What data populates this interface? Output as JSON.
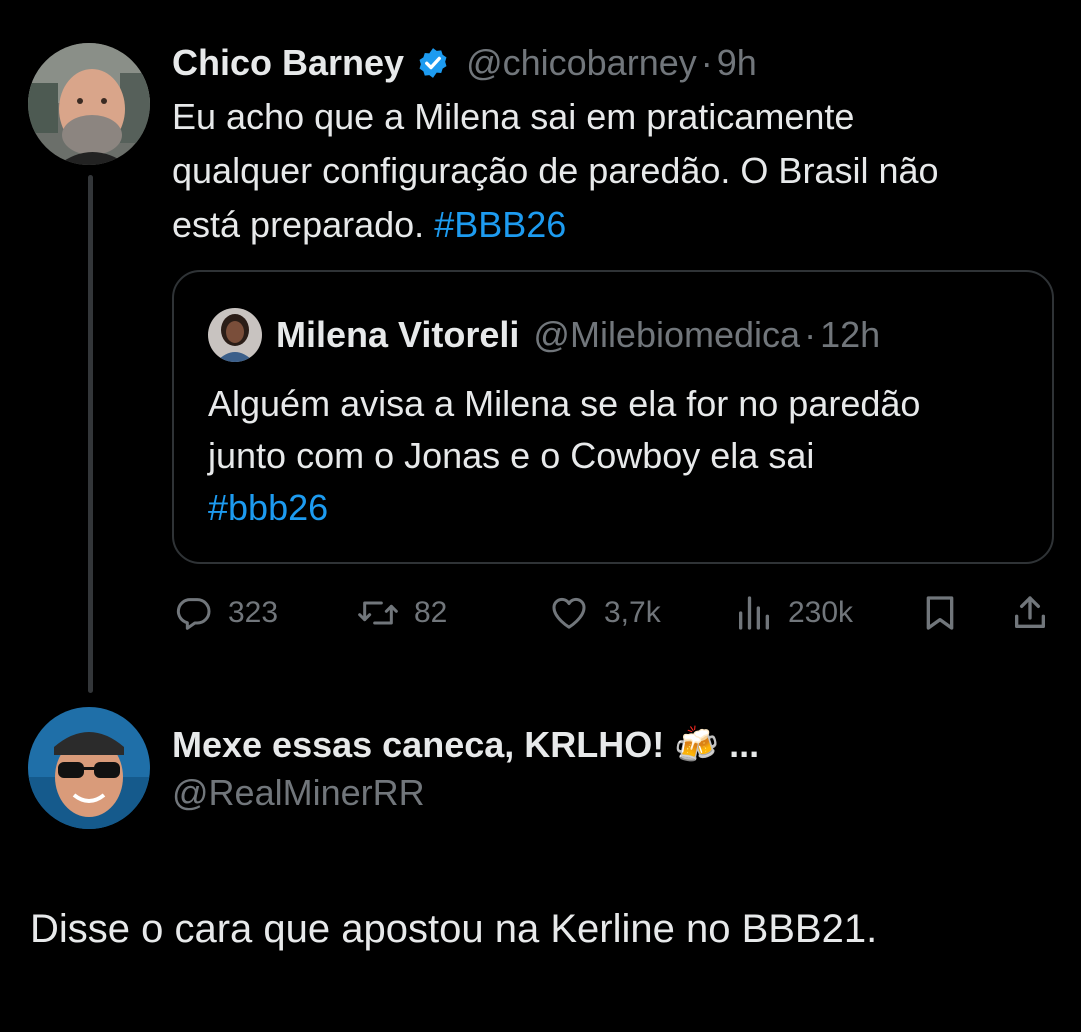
{
  "main_tweet": {
    "display_name": "Chico Barney",
    "handle": "@chicobarney",
    "time": "9h",
    "text_line1": "Eu acho que a Milena sai em praticamente",
    "text_line2": "qualquer configuração de paredão. O Brasil não",
    "text_line3": "está preparado.",
    "hashtag": "#BBB26",
    "quoted": {
      "display_name": "Milena Vitoreli",
      "handle": "@Milebiomedica",
      "time": "12h",
      "text_line1": "Alguém avisa a Milena se ela for no paredão",
      "text_line2": "junto com o Jonas e o Cowboy ela sai",
      "hashtag": "#bbb26"
    },
    "actions": {
      "replies": "323",
      "retweets": "82",
      "likes": "3,7k",
      "views": "230k"
    }
  },
  "reply": {
    "display_name": "Mexe essas caneca, KRLHO! 🍻 ...",
    "handle": "@RealMinerRR",
    "text": "Disse o cara que apostou na Kerline no BBB21."
  },
  "colors": {
    "background": "#000000",
    "text": "#e7e9ea",
    "muted": "#71767b",
    "link": "#1d9bf0",
    "verified": "#1d9bf0"
  }
}
